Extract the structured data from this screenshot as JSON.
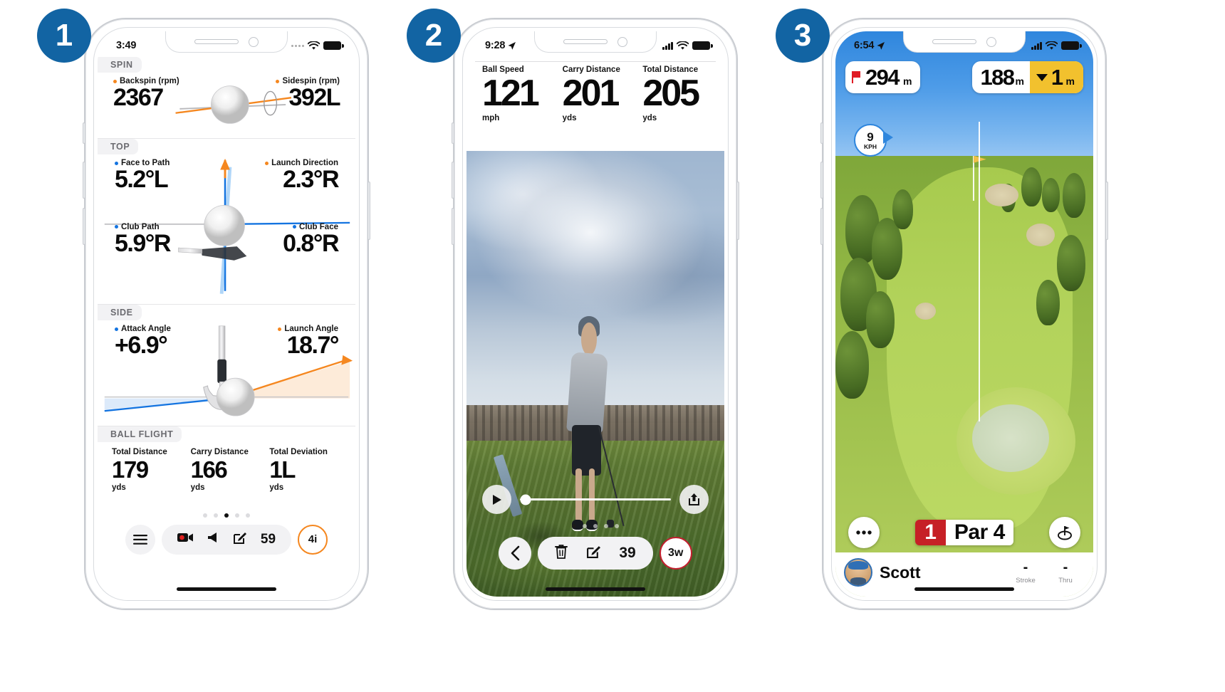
{
  "steps": [
    {
      "number": "1"
    },
    {
      "number": "2"
    },
    {
      "number": "3"
    }
  ],
  "phone1": {
    "status": {
      "time": "3:49",
      "wifi_icon": "wifi-icon",
      "battery_icon": "battery-icon"
    },
    "sections": [
      {
        "label": "SPIN",
        "metrics": [
          {
            "label": "Backspin (rpm)",
            "value": "2367",
            "dot": "orange",
            "align": "left"
          },
          {
            "label": "Sidespin (rpm)",
            "value": "392L",
            "dot": "orange",
            "align": "right"
          }
        ]
      },
      {
        "label": "TOP",
        "metrics": [
          {
            "label": "Face to Path",
            "value": "5.2°L",
            "dot": "blue",
            "align": "left"
          },
          {
            "label": "Launch Direction",
            "value": "2.3°R",
            "dot": "orange",
            "align": "right"
          },
          {
            "label": "Club Path",
            "value": "5.9°R",
            "dot": "blue",
            "align": "left"
          },
          {
            "label": "Club Face",
            "value": "0.8°R",
            "dot": "blue",
            "align": "right"
          }
        ]
      },
      {
        "label": "SIDE",
        "metrics": [
          {
            "label": "Attack Angle",
            "value": "+6.9°",
            "dot": "blue",
            "align": "left"
          },
          {
            "label": "Launch Angle",
            "value": "18.7°",
            "dot": "orange",
            "align": "right"
          }
        ]
      }
    ],
    "ball_flight": {
      "label": "BALL FLIGHT",
      "items": [
        {
          "label": "Total Distance",
          "value": "179",
          "unit": "yds"
        },
        {
          "label": "Carry Distance",
          "value": "166",
          "unit": "yds"
        },
        {
          "label": "Total Deviation",
          "value": "1L",
          "unit": "yds"
        }
      ]
    },
    "pagination": {
      "total": 5,
      "active_index": 2
    },
    "toolbar": {
      "menu_icon": "hamburger-menu-icon",
      "record_icon": "video-record-icon",
      "speaker_icon": "speaker-icon",
      "edit_icon": "edit-square-icon",
      "shot_number": "59",
      "club_badge": "4i"
    }
  },
  "phone2": {
    "status": {
      "time": "9:28",
      "location_icon": "location-arrow-icon",
      "signal_icon": "cellular-signal-icon",
      "wifi_icon": "wifi-icon",
      "battery_icon": "battery-icon"
    },
    "stats": [
      {
        "label": "Ball Speed",
        "value": "121",
        "unit": "mph"
      },
      {
        "label": "Carry Distance",
        "value": "201",
        "unit": "yds"
      },
      {
        "label": "Total Distance",
        "value": "205",
        "unit": "yds"
      }
    ],
    "player": {
      "play_icon": "play-icon",
      "share_icon": "share-upload-icon",
      "scrub_position_pct": 4
    },
    "pagination": {
      "total": 5,
      "active_index": 0
    },
    "toolbar": {
      "back_icon": "chevron-left-icon",
      "delete_icon": "trash-icon",
      "edit_icon": "edit-square-icon",
      "shot_number": "39",
      "club_badge": "3w"
    }
  },
  "phone3": {
    "status": {
      "time": "6:54",
      "location_icon": "location-arrow-icon",
      "signal_icon": "cellular-signal-icon",
      "wifi_icon": "wifi-icon",
      "battery_icon": "battery-icon"
    },
    "hud": {
      "pin_distance": {
        "icon": "flag-icon",
        "value": "294",
        "unit": "m"
      },
      "target_distance": {
        "value": "188",
        "unit": "m"
      },
      "elevation": {
        "direction_icon": "triangle-down-icon",
        "value": "1",
        "unit": "m"
      },
      "wind": {
        "speed": "9",
        "unit": "KPH",
        "arrow_icon": "wind-direction-arrow-icon"
      }
    },
    "bottom": {
      "more_icon": "ellipsis-icon",
      "hole_number": "1",
      "par_label": "Par 4",
      "green_view_icon": "green-view-icon"
    },
    "scorecard": {
      "avatar_icon": "player-avatar",
      "player_name": "Scott",
      "columns": [
        {
          "value": "-",
          "label": "Stroke"
        },
        {
          "value": "-",
          "label": "Thru"
        }
      ]
    }
  }
}
